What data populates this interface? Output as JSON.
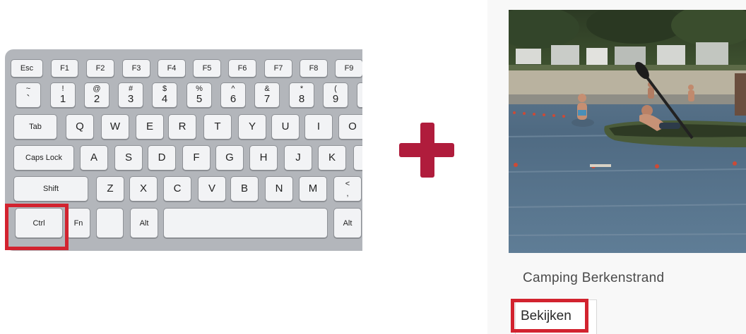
{
  "keyboard": {
    "rows": [
      [
        "Esc",
        "F1",
        "F2",
        "F3",
        "F4",
        "F5",
        "F6",
        "F7",
        "F8",
        "F9"
      ],
      [
        [
          "~",
          "`"
        ],
        [
          "!",
          "1"
        ],
        [
          "@",
          "2"
        ],
        [
          "#",
          "3"
        ],
        [
          "$",
          "4"
        ],
        [
          "%",
          "5"
        ],
        [
          "^",
          "6"
        ],
        [
          "&",
          "7"
        ],
        [
          "*",
          "8"
        ],
        [
          "(",
          "9"
        ]
      ],
      [
        "Tab",
        "Q",
        "W",
        "E",
        "R",
        "T",
        "Y",
        "U",
        "I",
        "O"
      ],
      [
        "Caps Lock",
        "A",
        "S",
        "D",
        "F",
        "G",
        "H",
        "J",
        "K"
      ],
      [
        "Shift",
        "Z",
        "X",
        "C",
        "V",
        "B",
        "N",
        "M",
        "<\n,"
      ],
      [
        "Ctrl",
        "Fn",
        "",
        "Alt",
        "",
        "Alt"
      ]
    ],
    "highlighted_key": "Ctrl"
  },
  "card": {
    "image_alt": "People swimming and kayaking in a lake at a campsite",
    "title": "Camping Berkenstrand",
    "link_label": "Bekijken"
  },
  "colors": {
    "highlight": "#d2232f",
    "plus": "#b01c3c",
    "keyboard_body": "#b3b6bb",
    "key_face": "#f2f3f5"
  }
}
